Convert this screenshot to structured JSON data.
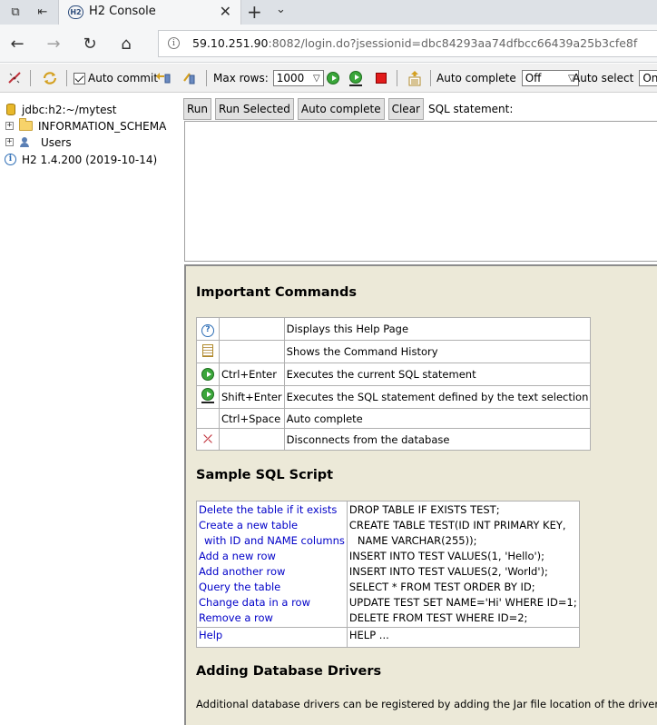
{
  "browser": {
    "tab_title": "H2 Console",
    "url_host": "59.10.251.90",
    "url_rest": ":8082/login.do?jsessionid=dbc84293aa74dfbcc66439a25b3cfe8f"
  },
  "toolbar": {
    "auto_commit_label": "Auto commit",
    "max_rows_label": "Max rows:",
    "max_rows_value": "1000",
    "auto_complete_label": "Auto complete",
    "auto_complete_value": "Off",
    "auto_select_label": "Auto select",
    "auto_select_value": "On"
  },
  "tree": {
    "connection": "jdbc:h2:~/mytest",
    "items": [
      {
        "label": "INFORMATION_SCHEMA"
      },
      {
        "label": "Users"
      }
    ],
    "version": "H2 1.4.200 (2019-10-14)"
  },
  "query": {
    "run": "Run",
    "run_selected": "Run Selected",
    "auto_complete": "Auto complete",
    "clear": "Clear",
    "sql_label": "SQL statement:",
    "sql_value": ""
  },
  "help": {
    "important_title": "Important Commands",
    "commands": [
      {
        "icon": "help-icon",
        "key": "",
        "desc": "Displays this Help Page"
      },
      {
        "icon": "history-icon",
        "key": "",
        "desc": "Shows the Command History"
      },
      {
        "icon": "run-icon",
        "key": "Ctrl+Enter",
        "desc": "Executes the current SQL statement"
      },
      {
        "icon": "run-selected-icon",
        "key": "Shift+Enter",
        "desc": "Executes the SQL statement defined by the text selection"
      },
      {
        "icon": "",
        "key": "Ctrl+Space",
        "desc": "Auto complete"
      },
      {
        "icon": "disconnect-icon",
        "key": "",
        "desc": "Disconnects from the database"
      }
    ],
    "sample_title": "Sample SQL Script",
    "script_links": [
      "Delete the table if it exists",
      "Create a new table",
      "with ID and NAME columns",
      "Add a new row",
      "Add another row",
      "Query the table",
      "Change data in a row",
      "Remove a row"
    ],
    "script_code": [
      "DROP TABLE IF EXISTS TEST;",
      "CREATE TABLE TEST(ID INT PRIMARY KEY,",
      "NAME VARCHAR(255));",
      "INSERT INTO TEST VALUES(1, 'Hello');",
      "INSERT INTO TEST VALUES(2, 'World');",
      "SELECT * FROM TEST ORDER BY ID;",
      "UPDATE TEST SET NAME='Hi' WHERE ID=1;",
      "DELETE FROM TEST WHERE ID=2;"
    ],
    "help_link": "Help",
    "help_code": "HELP ...",
    "drivers_title": "Adding Database Drivers",
    "drivers_text": "Additional database drivers can be registered by adding the Jar file location of the driver to the e"
  }
}
